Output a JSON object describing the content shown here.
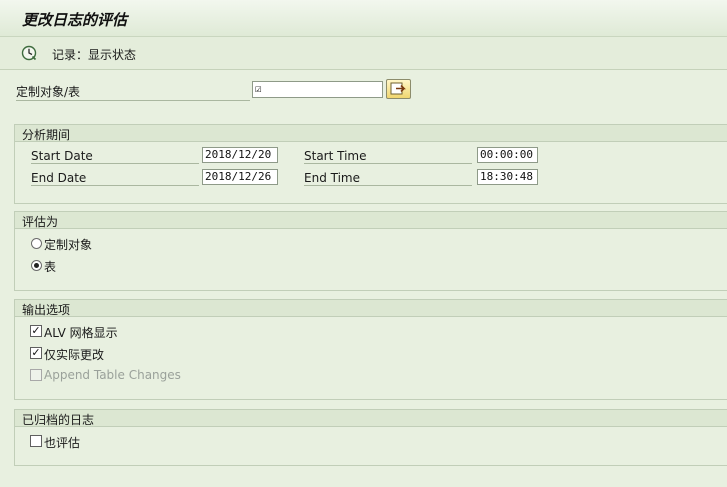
{
  "window": {
    "title": "更改日志的评估"
  },
  "toolbar": {
    "status_label": "记录：显示状态",
    "status_icon": "clock-execute-icon"
  },
  "selection": {
    "label": "定制对象/表",
    "field_value": "☑",
    "exec_icon": "arrow-right-icon"
  },
  "period": {
    "title": "分析期间",
    "start_date_label": "Start Date",
    "start_date": "2018/12/20",
    "end_date_label": "End Date",
    "end_date": "2018/12/26",
    "start_time_label": "Start Time",
    "start_time": "00:00:00",
    "end_time_label": "End Time",
    "end_time": "18:30:48"
  },
  "evaluate": {
    "title": "评估为",
    "options": [
      {
        "label": "定制对象",
        "selected": false
      },
      {
        "label": "表",
        "selected": true
      }
    ]
  },
  "output": {
    "title": "输出选项",
    "options": [
      {
        "label": "ALV 网格显示",
        "checked": true,
        "enabled": true
      },
      {
        "label": "仅实际更改",
        "checked": true,
        "enabled": true
      },
      {
        "label": "Append Table Changes",
        "checked": false,
        "enabled": false
      }
    ]
  },
  "archive": {
    "title": "已归档的日志",
    "options": [
      {
        "label": "也评估",
        "checked": false
      }
    ]
  },
  "colors": {
    "background": "#e8f0e0",
    "header": "#dce7d2",
    "button": "#f0d670"
  }
}
